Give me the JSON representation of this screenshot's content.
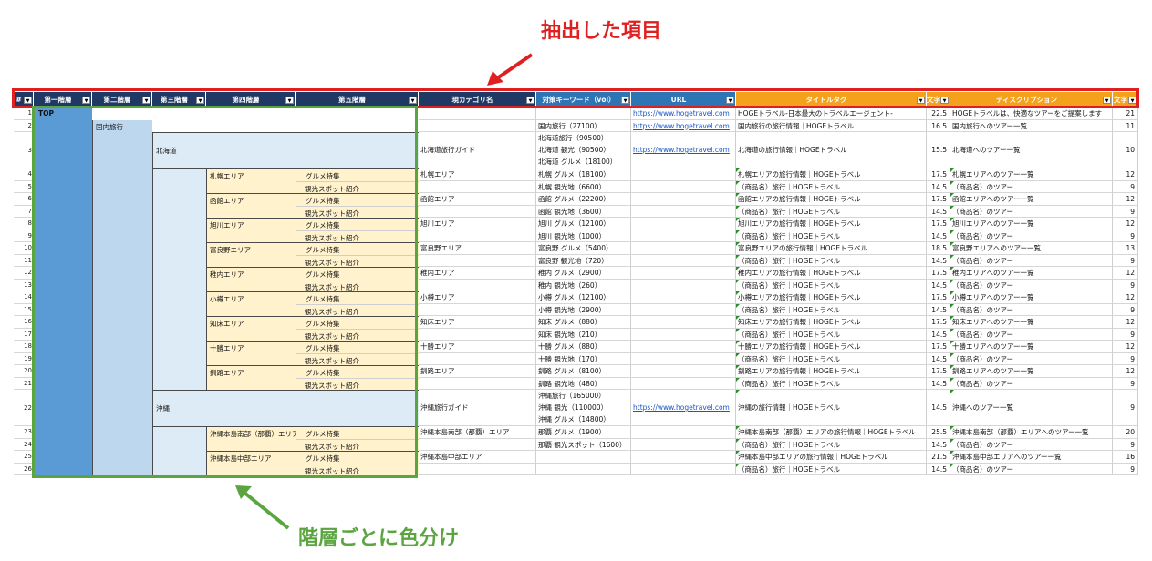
{
  "annotations": {
    "extracted_items": "抽出した項目",
    "color_by_level": "階層ごとに色分け"
  },
  "colors": {
    "header_dark": "#1f3864",
    "header_blue": "#2e75b6",
    "header_orange": "#f4a11c",
    "level1": "#5b9bd5",
    "level2": "#bdd7ee",
    "level3": "#ddebf7",
    "level4_5": "#fff2cc",
    "annotation_red": "#e02020",
    "annotation_green": "#5aa540"
  },
  "headers": [
    {
      "label": "#"
    },
    {
      "label": "第一階層"
    },
    {
      "label": "第二階層"
    },
    {
      "label": "第三階層"
    },
    {
      "label": "第四階層"
    },
    {
      "label": "第五階層"
    },
    {
      "label": "現カテゴリ名"
    },
    {
      "label": "対策キーワード（vol）"
    },
    {
      "label": "URL"
    },
    {
      "label": "タイトルタグ"
    },
    {
      "label": "文字"
    },
    {
      "label": "ディスクリプション"
    },
    {
      "label": "文字"
    }
  ],
  "hierarchy": {
    "level1": "TOP",
    "level2": "国内旅行",
    "hokkaido": "北海道",
    "okinawa": "沖縄",
    "areas": [
      "札幌エリア",
      "函館エリア",
      "旭川エリア",
      "富良野エリア",
      "稚内エリア",
      "小樽エリア",
      "知床エリア",
      "十勝エリア",
      "釧路エリア"
    ],
    "okinawa_areas": [
      "沖縄本島南部（那覇）エリア",
      "沖縄本島中部エリア"
    ],
    "gourmet": "グルメ特集",
    "spots": "観光スポット紹介"
  },
  "rows": [
    {
      "n": "1",
      "cat": "",
      "kw": [],
      "url": "https://www.hogetravel.com",
      "title": "HOGEトラベル-日本最大のトラベルエージェント-",
      "tlen": "22.5",
      "desc": "HOGEトラベルは、快適なツアーをご提案します",
      "dlen": "21"
    },
    {
      "n": "2",
      "cat": "",
      "kw": [
        "国内旅行（27100）"
      ],
      "url": "https://www.hogetravel.com",
      "title": "国内旅行の旅行情報｜HOGEトラベル",
      "tlen": "16.5",
      "desc": "国内旅行へのツアー一覧",
      "dlen": "11"
    },
    {
      "n": "3",
      "cat": "北海道旅行ガイド",
      "kw": [
        "北海道旅行（90500）",
        "北海道 観光（90500）",
        "北海道 グルメ（18100）"
      ],
      "url": "https://www.hogetravel.com",
      "title": "北海道の旅行情報｜HOGEトラベル",
      "tlen": "15.5",
      "desc": "北海道へのツアー一覧",
      "dlen": "10"
    },
    {
      "n": "4",
      "cat": "札幌エリア",
      "kw": [
        "札幌 グルメ（18100）"
      ],
      "url": "",
      "title": "札幌エリアの旅行情報｜HOGEトラベル",
      "tlen": "17.5",
      "desc": "札幌エリアへのツアー一覧",
      "dlen": "12"
    },
    {
      "n": "5",
      "cat": "",
      "kw": [
        "札幌 観光地（6600）"
      ],
      "url": "",
      "title": "（商品名）旅行｜HOGEトラベル",
      "tlen": "14.5",
      "desc": "（商品名）のツアー",
      "dlen": "9"
    },
    {
      "n": "6",
      "cat": "函館エリア",
      "kw": [
        "函館 グルメ（22200）"
      ],
      "url": "",
      "title": "函館エリアの旅行情報｜HOGEトラベル",
      "tlen": "17.5",
      "desc": "函館エリアへのツアー一覧",
      "dlen": "12"
    },
    {
      "n": "7",
      "cat": "",
      "kw": [
        "函館 観光地（3600）"
      ],
      "url": "",
      "title": "（商品名）旅行｜HOGEトラベル",
      "tlen": "14.5",
      "desc": "（商品名）のツアー",
      "dlen": "9"
    },
    {
      "n": "8",
      "cat": "旭川エリア",
      "kw": [
        "旭川 グルメ（12100）"
      ],
      "url": "",
      "title": "旭川エリアの旅行情報｜HOGEトラベル",
      "tlen": "17.5",
      "desc": "旭川エリアへのツアー一覧",
      "dlen": "12"
    },
    {
      "n": "9",
      "cat": "",
      "kw": [
        "旭川 観光地（1000）"
      ],
      "url": "",
      "title": "（商品名）旅行｜HOGEトラベル",
      "tlen": "14.5",
      "desc": "（商品名）のツアー",
      "dlen": "9"
    },
    {
      "n": "10",
      "cat": "富良野エリア",
      "kw": [
        "富良野 グルメ（5400）"
      ],
      "url": "",
      "title": "富良野エリアの旅行情報｜HOGEトラベル",
      "tlen": "18.5",
      "desc": "富良野エリアへのツアー一覧",
      "dlen": "13"
    },
    {
      "n": "11",
      "cat": "",
      "kw": [
        "富良野 観光地（720）"
      ],
      "url": "",
      "title": "（商品名）旅行｜HOGEトラベル",
      "tlen": "14.5",
      "desc": "（商品名）のツアー",
      "dlen": "9"
    },
    {
      "n": "12",
      "cat": "稚内エリア",
      "kw": [
        "稚内 グルメ（2900）"
      ],
      "url": "",
      "title": "稚内エリアの旅行情報｜HOGEトラベル",
      "tlen": "17.5",
      "desc": "稚内エリアへのツアー一覧",
      "dlen": "12"
    },
    {
      "n": "13",
      "cat": "",
      "kw": [
        "稚内 観光地（260）"
      ],
      "url": "",
      "title": "（商品名）旅行｜HOGEトラベル",
      "tlen": "14.5",
      "desc": "（商品名）のツアー",
      "dlen": "9"
    },
    {
      "n": "14",
      "cat": "小樽エリア",
      "kw": [
        "小樽 グルメ（12100）"
      ],
      "url": "",
      "title": "小樽エリアの旅行情報｜HOGEトラベル",
      "tlen": "17.5",
      "desc": "小樽エリアへのツアー一覧",
      "dlen": "12"
    },
    {
      "n": "15",
      "cat": "",
      "kw": [
        "小樽 観光地（2900）"
      ],
      "url": "",
      "title": "（商品名）旅行｜HOGEトラベル",
      "tlen": "14.5",
      "desc": "（商品名）のツアー",
      "dlen": "9"
    },
    {
      "n": "16",
      "cat": "知床エリア",
      "kw": [
        "知床 グルメ（880）"
      ],
      "url": "",
      "title": "知床エリアの旅行情報｜HOGEトラベル",
      "tlen": "17.5",
      "desc": "知床エリアへのツアー一覧",
      "dlen": "12"
    },
    {
      "n": "17",
      "cat": "",
      "kw": [
        "知床 観光地（210）"
      ],
      "url": "",
      "title": "（商品名）旅行｜HOGEトラベル",
      "tlen": "14.5",
      "desc": "（商品名）のツアー",
      "dlen": "9"
    },
    {
      "n": "18",
      "cat": "十勝エリア",
      "kw": [
        "十勝 グルメ（880）"
      ],
      "url": "",
      "title": "十勝エリアの旅行情報｜HOGEトラベル",
      "tlen": "17.5",
      "desc": "十勝エリアへのツアー一覧",
      "dlen": "12"
    },
    {
      "n": "19",
      "cat": "",
      "kw": [
        "十勝 観光地（170）"
      ],
      "url": "",
      "title": "（商品名）旅行｜HOGEトラベル",
      "tlen": "14.5",
      "desc": "（商品名）のツアー",
      "dlen": "9"
    },
    {
      "n": "20",
      "cat": "釧路エリア",
      "kw": [
        "釧路 グルメ（8100）"
      ],
      "url": "",
      "title": "釧路エリアの旅行情報｜HOGEトラベル",
      "tlen": "17.5",
      "desc": "釧路エリアへのツアー一覧",
      "dlen": "12"
    },
    {
      "n": "21",
      "cat": "",
      "kw": [
        "釧路 観光地（480）"
      ],
      "url": "",
      "title": "（商品名）旅行｜HOGEトラベル",
      "tlen": "14.5",
      "desc": "（商品名）のツアー",
      "dlen": "9"
    },
    {
      "n": "22",
      "cat": "沖縄旅行ガイド",
      "kw": [
        "沖縄旅行（165000）",
        "沖縄 観光（110000）",
        "沖縄 グルメ（14800）"
      ],
      "url": "https://www.hogetravel.com",
      "title": "沖縄の旅行情報｜HOGEトラベル",
      "tlen": "14.5",
      "desc": "沖縄へのツアー一覧",
      "dlen": "9"
    },
    {
      "n": "23",
      "cat": "沖縄本島南部（那覇）エリア",
      "kw": [
        "那覇 グルメ（1900）"
      ],
      "url": "",
      "title": "沖縄本島南部（那覇）エリアの旅行情報｜HOGEトラベル",
      "tlen": "25.5",
      "desc": "沖縄本島南部（那覇）エリアへのツアー一覧",
      "dlen": "20"
    },
    {
      "n": "24",
      "cat": "",
      "kw": [
        "那覇 観光スポット（1600）"
      ],
      "url": "",
      "title": "（商品名）旅行｜HOGEトラベル",
      "tlen": "14.5",
      "desc": "（商品名）のツアー",
      "dlen": "9"
    },
    {
      "n": "25",
      "cat": "沖縄本島中部エリア",
      "kw": [],
      "url": "",
      "title": "沖縄本島中部エリアの旅行情報｜HOGEトラベル",
      "tlen": "21.5",
      "desc": "沖縄本島中部エリアへのツアー一覧",
      "dlen": "16"
    },
    {
      "n": "26",
      "cat": "",
      "kw": [],
      "url": "",
      "title": "（商品名）旅行｜HOGEトラベル",
      "tlen": "14.5",
      "desc": "（商品名）のツアー",
      "dlen": "9"
    }
  ]
}
